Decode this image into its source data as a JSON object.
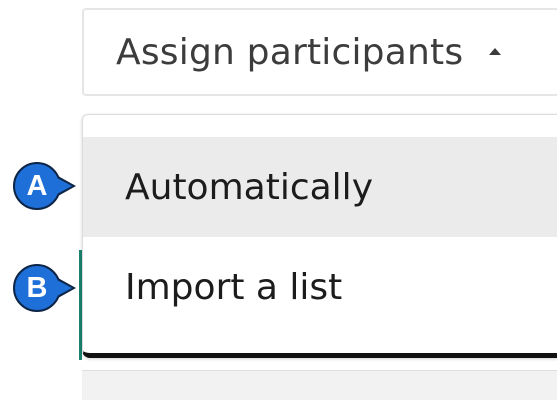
{
  "assign_button": {
    "label": "Assign participants",
    "icon": "caret-up-icon"
  },
  "menu": {
    "items": [
      {
        "label": "Automatically",
        "highlighted": true
      },
      {
        "label": "Import a list",
        "highlighted": false
      }
    ]
  },
  "callouts": [
    {
      "letter": "A"
    },
    {
      "letter": "B"
    }
  ],
  "colors": {
    "callout_fill": "#1f6fd8",
    "callout_border": "#0d2547",
    "highlight": "#ebebeb",
    "accent_teal": "#19836f"
  }
}
